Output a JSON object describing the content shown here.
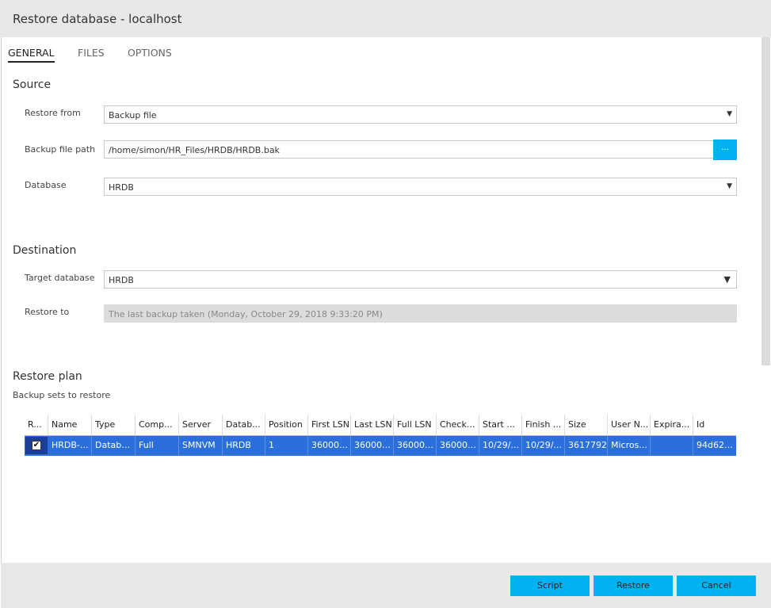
{
  "window": {
    "title": "Restore database - localhost"
  },
  "tabs": [
    {
      "label": "GENERAL",
      "active": true
    },
    {
      "label": "FILES",
      "active": false
    },
    {
      "label": "OPTIONS",
      "active": false
    }
  ],
  "source": {
    "heading": "Source",
    "restore_from": {
      "label": "Restore from",
      "value": "Backup file"
    },
    "backup_file_path": {
      "label": "Backup file path",
      "value": "/home/simon/HR_Files/HRDB/HRDB.bak",
      "browse_label": "..."
    },
    "database": {
      "label": "Database",
      "value": "HRDB"
    }
  },
  "destination": {
    "heading": "Destination",
    "target_database": {
      "label": "Target database",
      "value": "HRDB"
    },
    "restore_to": {
      "label": "Restore to",
      "value": "The last backup taken (Monday, October 29, 2018 9:33:20 PM)"
    }
  },
  "restore_plan": {
    "heading": "Restore plan",
    "subtitle": "Backup sets to restore",
    "columns": [
      "R...",
      "Name",
      "Type",
      "Comp...",
      "Server",
      "Datab...",
      "Position",
      "First LSN",
      "Last LSN",
      "Full LSN",
      "Check...",
      "Start ...",
      "Finish ...",
      "Size",
      "User N...",
      "Expira...",
      "Id"
    ],
    "rows": [
      {
        "checked": true,
        "cells": [
          "HRDB-...",
          "Database",
          "Full",
          "SMNVM",
          "HRDB",
          "1",
          "360000...",
          "360000...",
          "360000...",
          "360000...",
          "10/29/...",
          "10/29/...",
          "3617792",
          "Micros...",
          "",
          "94d625..."
        ]
      }
    ]
  },
  "footer": {
    "script_label": "Script",
    "restore_label": "Restore",
    "cancel_label": "Cancel"
  },
  "colors": {
    "accent": "#00b3f0",
    "selection": "#2a6fdb"
  }
}
